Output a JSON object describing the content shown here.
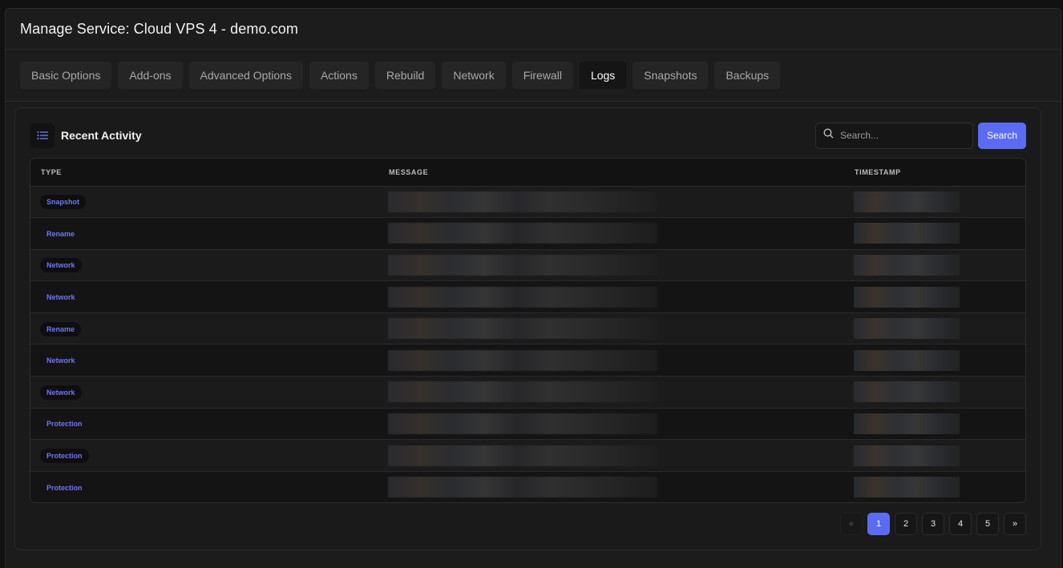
{
  "page_title": "Manage Service: Cloud VPS 4 - demo.com",
  "tabs": [
    {
      "label": "Basic Options",
      "active": false
    },
    {
      "label": "Add-ons",
      "active": false
    },
    {
      "label": "Advanced Options",
      "active": false
    },
    {
      "label": "Actions",
      "active": false
    },
    {
      "label": "Rebuild",
      "active": false
    },
    {
      "label": "Network",
      "active": false
    },
    {
      "label": "Firewall",
      "active": false
    },
    {
      "label": "Logs",
      "active": true
    },
    {
      "label": "Snapshots",
      "active": false
    },
    {
      "label": "Backups",
      "active": false
    }
  ],
  "activity": {
    "title": "Recent Activity",
    "icon": "list-icon",
    "search": {
      "placeholder": "Search...",
      "button_label": "Search"
    },
    "columns": {
      "type": "TYPE",
      "message": "MESSAGE",
      "timestamp": "TIMESTAMP"
    },
    "rows": [
      {
        "type": "Snapshot"
      },
      {
        "type": "Rename"
      },
      {
        "type": "Network"
      },
      {
        "type": "Network"
      },
      {
        "type": "Rename"
      },
      {
        "type": "Network"
      },
      {
        "type": "Network"
      },
      {
        "type": "Protection"
      },
      {
        "type": "Protection"
      },
      {
        "type": "Protection"
      }
    ]
  },
  "pagination": {
    "prev": "«",
    "next": "»",
    "pages": [
      "1",
      "2",
      "3",
      "4",
      "5"
    ],
    "current": "1"
  },
  "colors": {
    "accent": "#5b6cf2",
    "badge_text": "#6d78f5",
    "background": "#111111"
  }
}
